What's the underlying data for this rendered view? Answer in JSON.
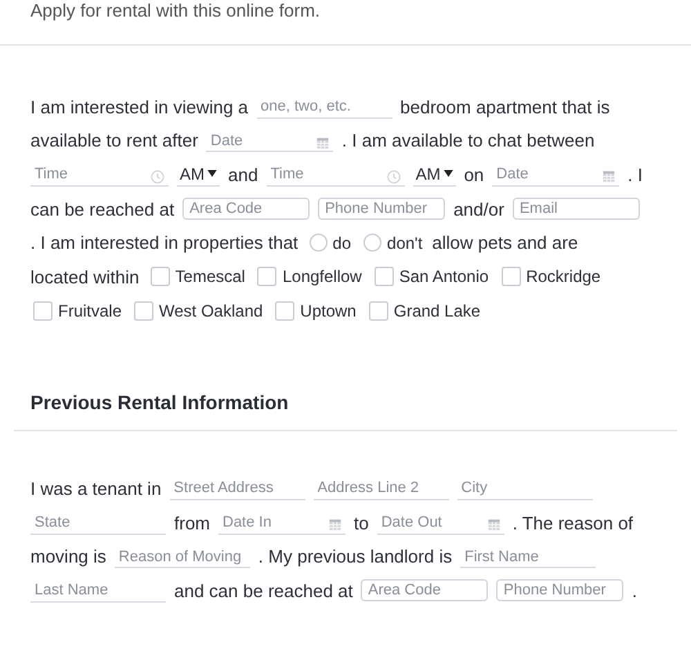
{
  "intro": "Apply for rental with this online form.",
  "sections": [
    {
      "items": [
        {
          "kind": "text",
          "text": "I am interested in viewing a"
        },
        {
          "kind": "line",
          "placeholder": "one, two, etc."
        },
        {
          "kind": "text",
          "text": "bedroom apartment that is"
        },
        {
          "kind": "text",
          "text": "available to rent after"
        },
        {
          "kind": "date",
          "placeholder": "Date"
        },
        {
          "kind": "text",
          "text": ". I am available to chat between"
        },
        {
          "kind": "time",
          "placeholder": "Time"
        },
        {
          "kind": "select",
          "value": "AM"
        },
        {
          "kind": "text",
          "text": "and"
        },
        {
          "kind": "time",
          "placeholder": "Time"
        },
        {
          "kind": "select",
          "value": "AM"
        },
        {
          "kind": "text",
          "text": "on"
        },
        {
          "kind": "date",
          "placeholder": "Date"
        },
        {
          "kind": "text",
          "text": ". I"
        },
        {
          "kind": "text",
          "text": "can be reached at"
        },
        {
          "kind": "box",
          "placeholder": "Area Code"
        },
        {
          "kind": "box",
          "placeholder": "Phone Number"
        },
        {
          "kind": "text",
          "text": "and/or"
        },
        {
          "kind": "box",
          "placeholder": "Email"
        },
        {
          "kind": "text",
          "text": ". I am interested in properties that"
        },
        {
          "kind": "radio",
          "label": "do",
          "selected": false
        },
        {
          "kind": "radio",
          "label": "don't",
          "selected": false
        },
        {
          "kind": "text",
          "text": "allow pets and are"
        },
        {
          "kind": "text",
          "text": "located within"
        },
        {
          "kind": "checkbox",
          "label": "Temescal",
          "checked": false
        },
        {
          "kind": "checkbox",
          "label": "Longfellow",
          "checked": false
        },
        {
          "kind": "checkbox",
          "label": "San Antonio",
          "checked": false
        },
        {
          "kind": "checkbox",
          "label": "Rockridge",
          "checked": false
        },
        {
          "kind": "checkbox",
          "label": "Fruitvale",
          "checked": false
        },
        {
          "kind": "checkbox",
          "label": "West Oakland",
          "checked": false
        },
        {
          "kind": "checkbox",
          "label": "Uptown",
          "checked": false
        },
        {
          "kind": "checkbox",
          "label": "Grand Lake",
          "checked": false
        }
      ]
    },
    {
      "heading": "Previous Rental Information",
      "items": [
        {
          "kind": "text",
          "text": "I was a tenant in"
        },
        {
          "kind": "line",
          "placeholder": "Street Address"
        },
        {
          "kind": "line",
          "placeholder": "Address Line 2"
        },
        {
          "kind": "line",
          "placeholder": "City"
        },
        {
          "kind": "line",
          "placeholder": "State"
        },
        {
          "kind": "text",
          "text": "from"
        },
        {
          "kind": "date",
          "placeholder": "Date In"
        },
        {
          "kind": "text",
          "text": "to"
        },
        {
          "kind": "date",
          "placeholder": "Date Out"
        },
        {
          "kind": "text",
          "text": ". The reason of"
        },
        {
          "kind": "text",
          "text": "moving is"
        },
        {
          "kind": "line",
          "placeholder": "Reason of Moving"
        },
        {
          "kind": "text",
          "text": ". My previous landlord is"
        },
        {
          "kind": "line",
          "placeholder": "First Name"
        },
        {
          "kind": "line",
          "placeholder": "Last Name"
        },
        {
          "kind": "text",
          "text": "and can be reached at"
        },
        {
          "kind": "box",
          "placeholder": "Area Code"
        },
        {
          "kind": "box",
          "placeholder": "Phone Number"
        },
        {
          "kind": "text",
          "text": "."
        }
      ]
    }
  ]
}
